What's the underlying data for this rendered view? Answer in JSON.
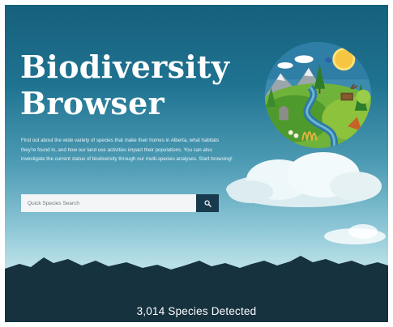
{
  "hero": {
    "title_line1": "Biodiversity",
    "title_line2": "Browser",
    "description": "Find out about the wide variety of species that make their homes in Alberta, what habitats they're found in, and how our land use activities impact their populations. You can also investigate the current status of biodiversity through our multi-species analyses. Start browsing!"
  },
  "search": {
    "placeholder": "Quick Species Search",
    "icon": "search-icon"
  },
  "stats": {
    "species_detected": "3,014 Species Detected"
  },
  "colors": {
    "sky_top": "#16607c",
    "sky_bottom": "#b9e0e8",
    "mountains": "#17323f",
    "search_button": "#173a4c"
  }
}
